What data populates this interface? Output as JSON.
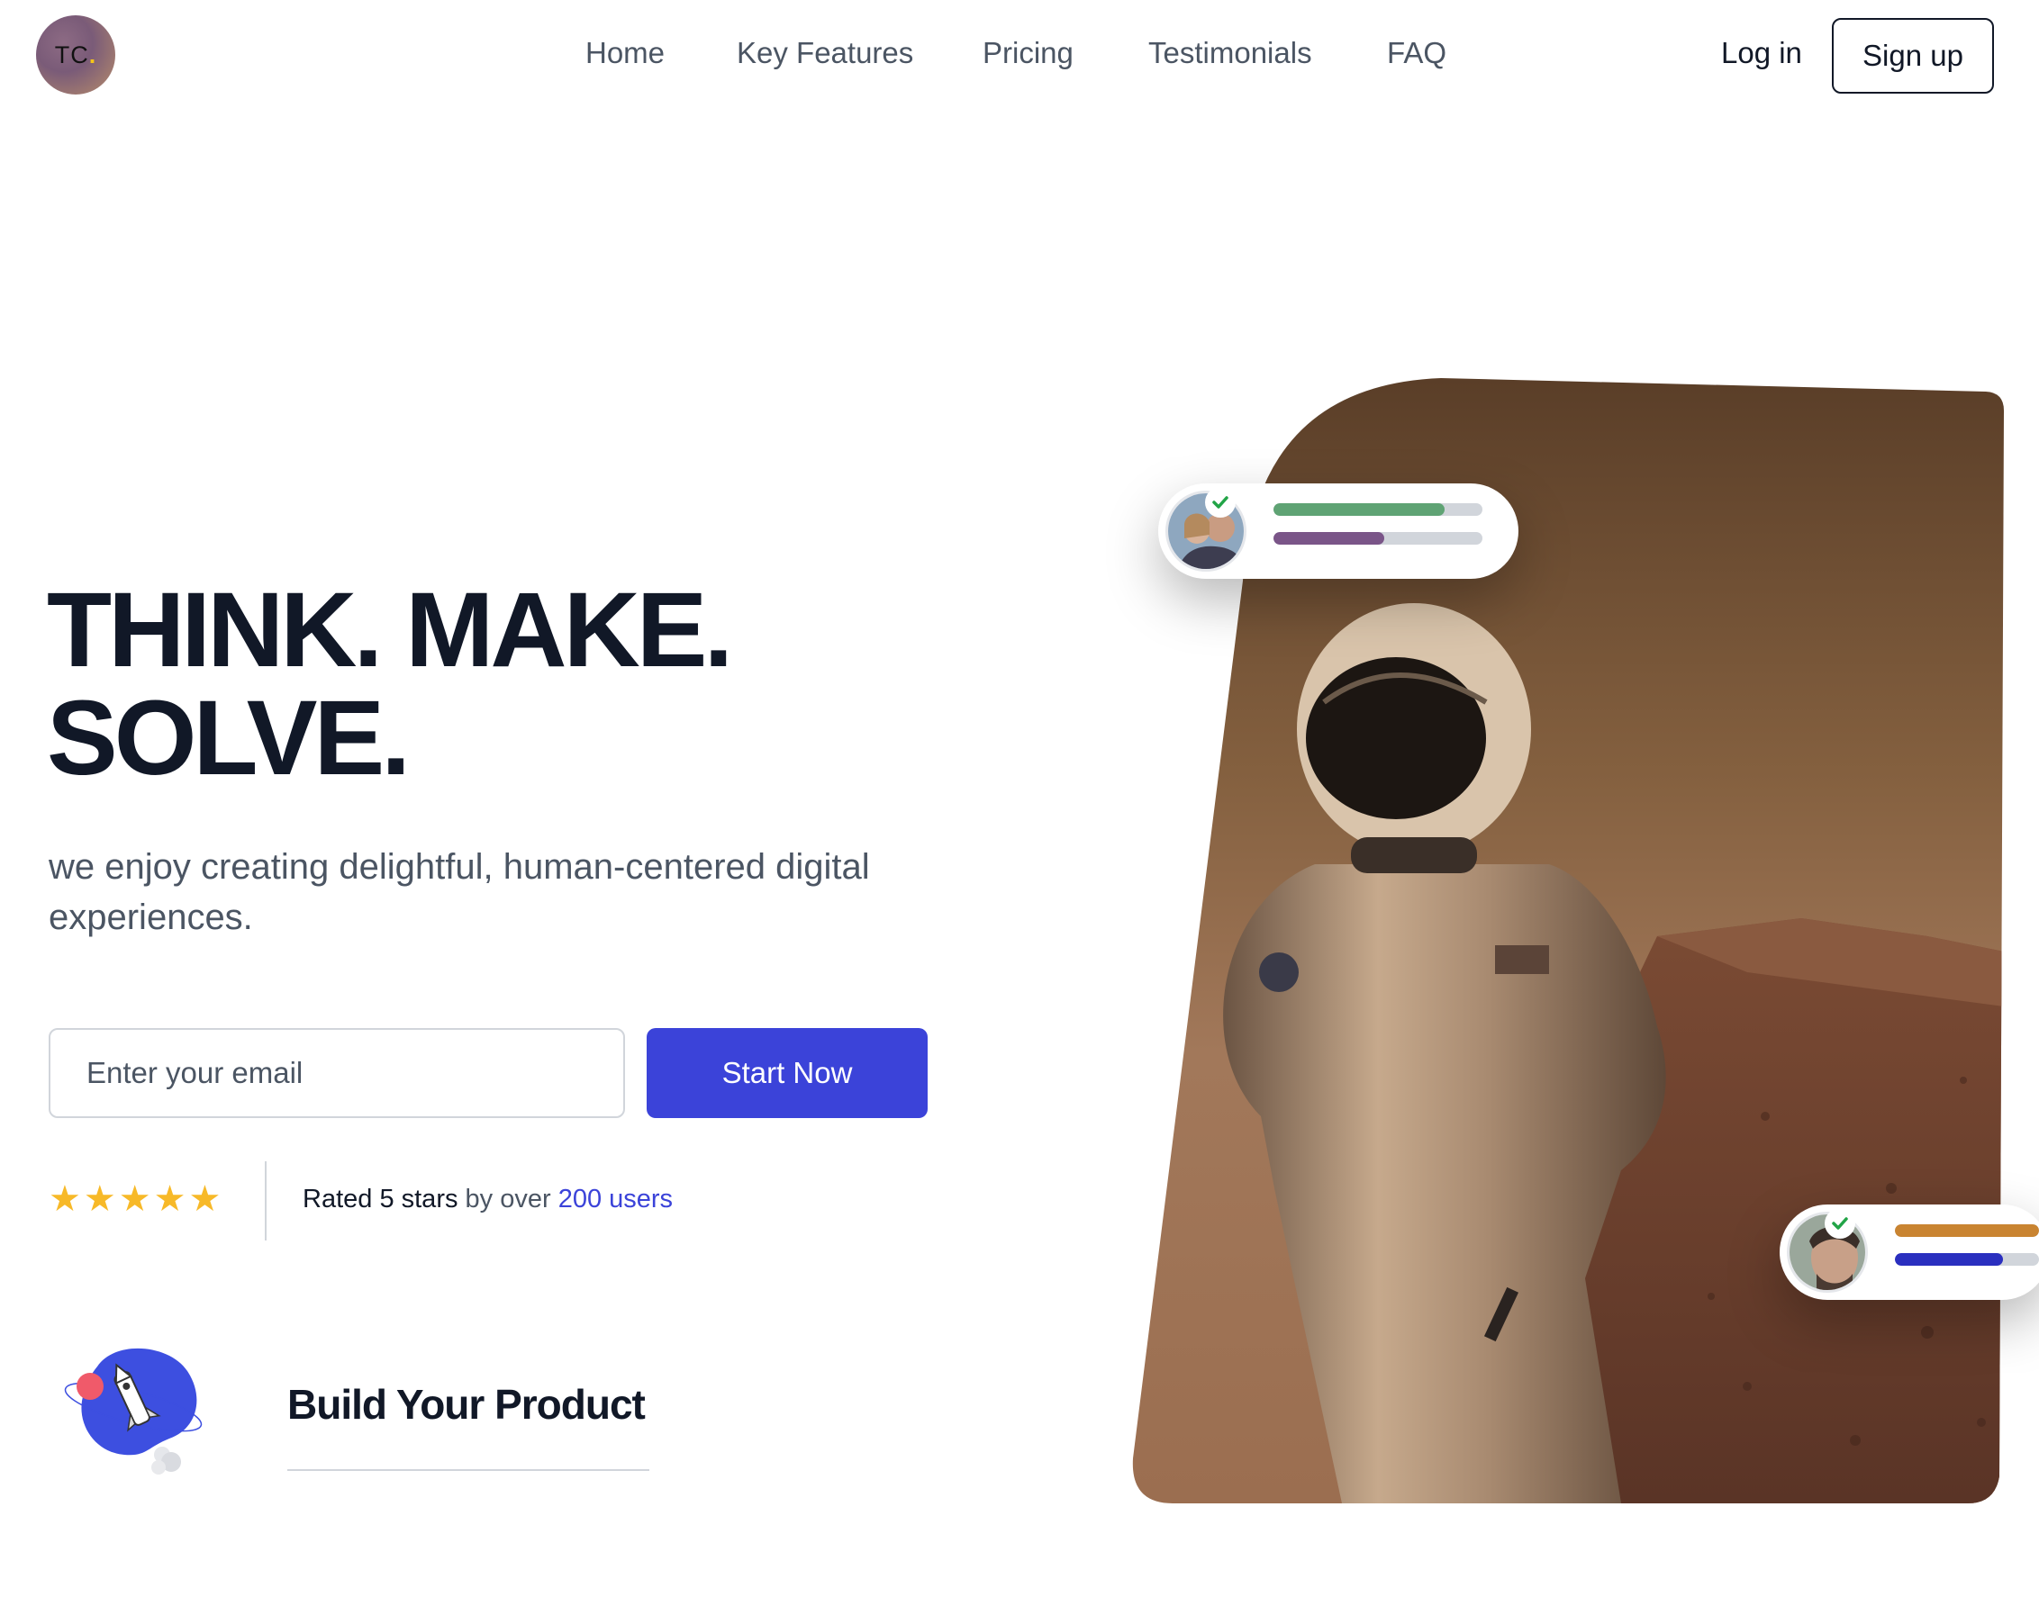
{
  "brand": {
    "logo_text": "TC",
    "logo_dot": "."
  },
  "nav": {
    "links": [
      "Home",
      "Key Features",
      "Pricing",
      "Testimonials",
      "FAQ"
    ],
    "login_label": "Log in",
    "signup_label": "Sign up"
  },
  "hero": {
    "title_line1": "THINK. MAKE.",
    "title_line2": "SOLVE.",
    "subtitle": "we enjoy creating delightful, human-centered digital experiences.",
    "email_placeholder": "Enter your email",
    "cta_label": "Start Now"
  },
  "rating": {
    "stars": 5,
    "prefix": "Rated 5 stars",
    "middle": " by over ",
    "link": "200 users"
  },
  "feature": {
    "title": "Build Your Product"
  },
  "user_cards": [
    {
      "bars": [
        {
          "color": "#5fa374",
          "fill": 0.82
        },
        {
          "color": "#7a5588",
          "fill": 0.53
        }
      ]
    },
    {
      "bars": [
        {
          "color": "#c98431",
          "fill": 1.0
        },
        {
          "color": "#2a2fbf",
          "fill": 0.75
        }
      ]
    }
  ],
  "colors": {
    "accent": "#3b43d9",
    "star": "#f7b928",
    "check": "#22a447"
  }
}
